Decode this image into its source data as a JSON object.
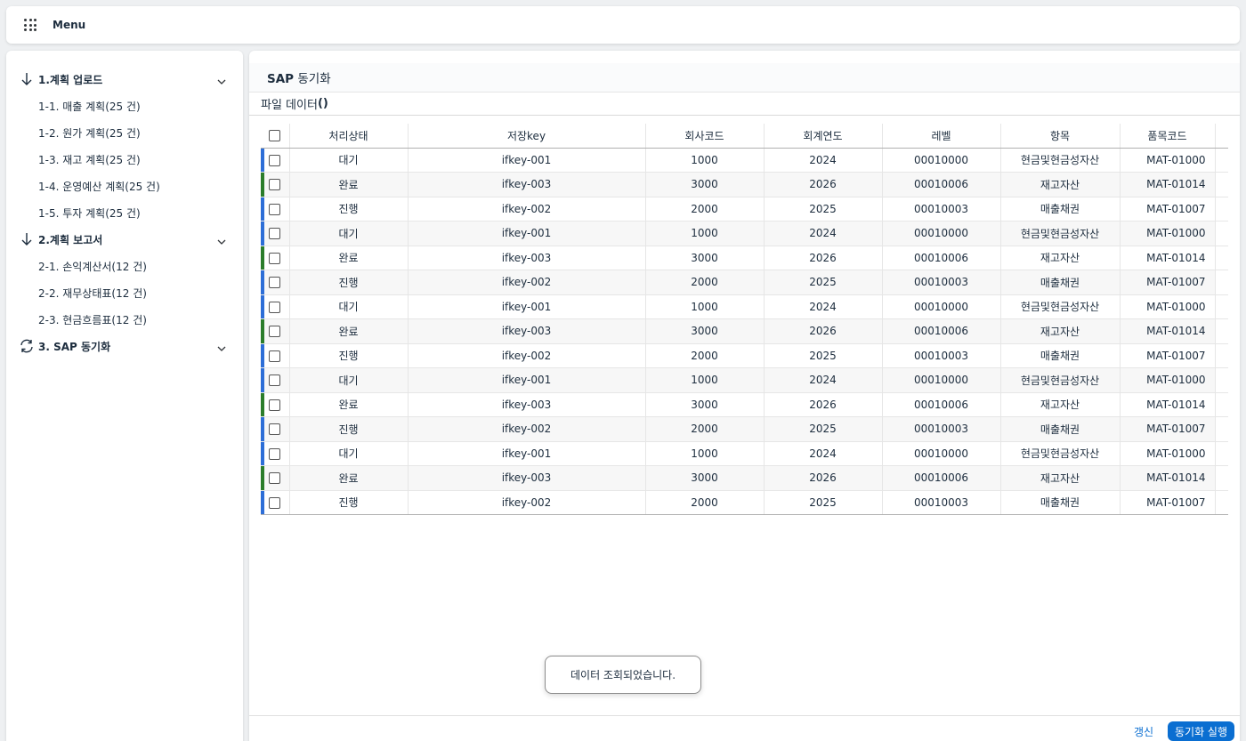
{
  "topbar": {
    "menu_label": "Menu"
  },
  "sidebar": {
    "groups": [
      {
        "label": "1.계획 업로드",
        "icon": "arrow-down-icon",
        "items": [
          "1-1. 매출 계획(25 건)",
          "1-2. 원가 계획(25 건)",
          "1-3. 재고 계획(25 건)",
          "1-4. 운영예산 계획(25 건)",
          "1-5. 투자 계획(25 건)"
        ]
      },
      {
        "label": "2.계획 보고서",
        "icon": "arrow-down-icon",
        "items": [
          "2-1. 손익계산서(12 건)",
          "2-2. 재무상태표(12 건)",
          "2-3. 현금흐름표(12 건)"
        ]
      },
      {
        "label": "3. SAP 동기화",
        "icon": "sync-icon",
        "items": []
      }
    ]
  },
  "main": {
    "title_bold": "SAP",
    "title_rest": " 동기화",
    "section_label": "파일 데이터",
    "section_count": "()",
    "columns": [
      "처리상태",
      "저장key",
      "회사코드",
      "회계연도",
      "레벨",
      "항목",
      "품목코드"
    ],
    "rows": [
      [
        "대기",
        "ifkey-001",
        "1000",
        "2024",
        "00010000",
        "현금및현금성자산",
        "MAT-01000"
      ],
      [
        "완료",
        "ifkey-003",
        "3000",
        "2026",
        "00010006",
        "재고자산",
        "MAT-01014"
      ],
      [
        "진행",
        "ifkey-002",
        "2000",
        "2025",
        "00010003",
        "매출채권",
        "MAT-01007"
      ],
      [
        "대기",
        "ifkey-001",
        "1000",
        "2024",
        "00010000",
        "현금및현금성자산",
        "MAT-01000"
      ],
      [
        "완료",
        "ifkey-003",
        "3000",
        "2026",
        "00010006",
        "재고자산",
        "MAT-01014"
      ],
      [
        "진행",
        "ifkey-002",
        "2000",
        "2025",
        "00010003",
        "매출채권",
        "MAT-01007"
      ],
      [
        "대기",
        "ifkey-001",
        "1000",
        "2024",
        "00010000",
        "현금및현금성자산",
        "MAT-01000"
      ],
      [
        "완료",
        "ifkey-003",
        "3000",
        "2026",
        "00010006",
        "재고자산",
        "MAT-01014"
      ],
      [
        "진행",
        "ifkey-002",
        "2000",
        "2025",
        "00010003",
        "매출채권",
        "MAT-01007"
      ],
      [
        "대기",
        "ifkey-001",
        "1000",
        "2024",
        "00010000",
        "현금및현금성자산",
        "MAT-01000"
      ],
      [
        "완료",
        "ifkey-003",
        "3000",
        "2026",
        "00010006",
        "재고자산",
        "MAT-01014"
      ],
      [
        "진행",
        "ifkey-002",
        "2000",
        "2025",
        "00010003",
        "매출채권",
        "MAT-01007"
      ],
      [
        "대기",
        "ifkey-001",
        "1000",
        "2024",
        "00010000",
        "현금및현금성자산",
        "MAT-01000"
      ],
      [
        "완료",
        "ifkey-003",
        "3000",
        "2026",
        "00010006",
        "재고자산",
        "MAT-01014"
      ],
      [
        "진행",
        "ifkey-002",
        "2000",
        "2025",
        "00010003",
        "매출채권",
        "MAT-01007"
      ]
    ],
    "status_colors": {
      "대기": "#2d6ed7",
      "완료": "#2b7d2b",
      "진행": "#2d6ed7"
    }
  },
  "footer": {
    "refresh_label": "갱신",
    "sync_label": "동기화 실행"
  },
  "toast": {
    "message": "데이터 조회되었습니다."
  }
}
